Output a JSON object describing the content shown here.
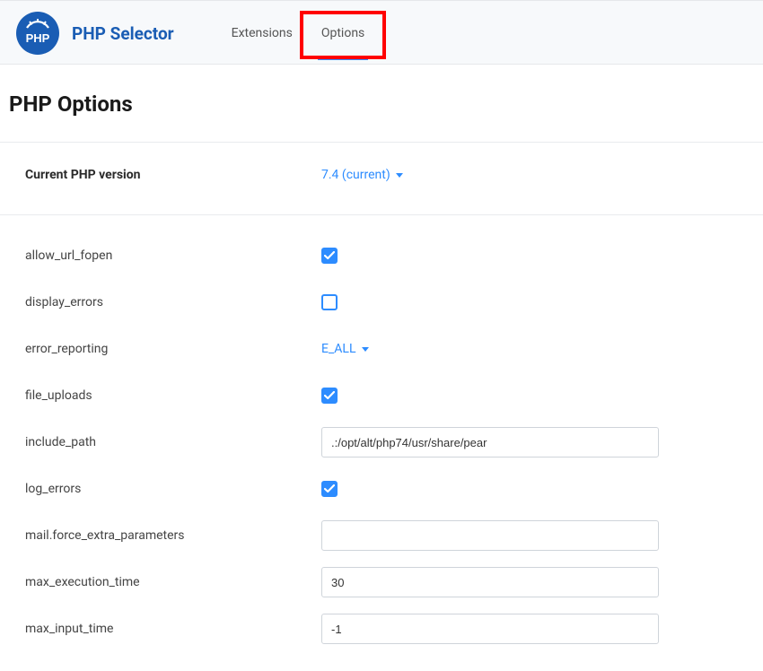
{
  "header": {
    "app_title": "PHP Selector",
    "tabs": {
      "extensions": "Extensions",
      "options": "Options"
    }
  },
  "page": {
    "title": "PHP Options"
  },
  "version": {
    "label": "Current PHP version",
    "value": "7.4 (current)"
  },
  "options": [
    {
      "key": "allow_url_fopen",
      "label": "allow_url_fopen",
      "type": "checkbox",
      "checked": true
    },
    {
      "key": "display_errors",
      "label": "display_errors",
      "type": "checkbox",
      "checked": false
    },
    {
      "key": "error_reporting",
      "label": "error_reporting",
      "type": "dropdown",
      "value": "E_ALL"
    },
    {
      "key": "file_uploads",
      "label": "file_uploads",
      "type": "checkbox",
      "checked": true
    },
    {
      "key": "include_path",
      "label": "include_path",
      "type": "text",
      "value": ".:/opt/alt/php74/usr/share/pear"
    },
    {
      "key": "log_errors",
      "label": "log_errors",
      "type": "checkbox",
      "checked": true
    },
    {
      "key": "mail_force_extra_parameters",
      "label": "mail.force_extra_parameters",
      "type": "text",
      "value": ""
    },
    {
      "key": "max_execution_time",
      "label": "max_execution_time",
      "type": "text",
      "value": "30"
    },
    {
      "key": "max_input_time",
      "label": "max_input_time",
      "type": "text",
      "value": "-1"
    }
  ]
}
